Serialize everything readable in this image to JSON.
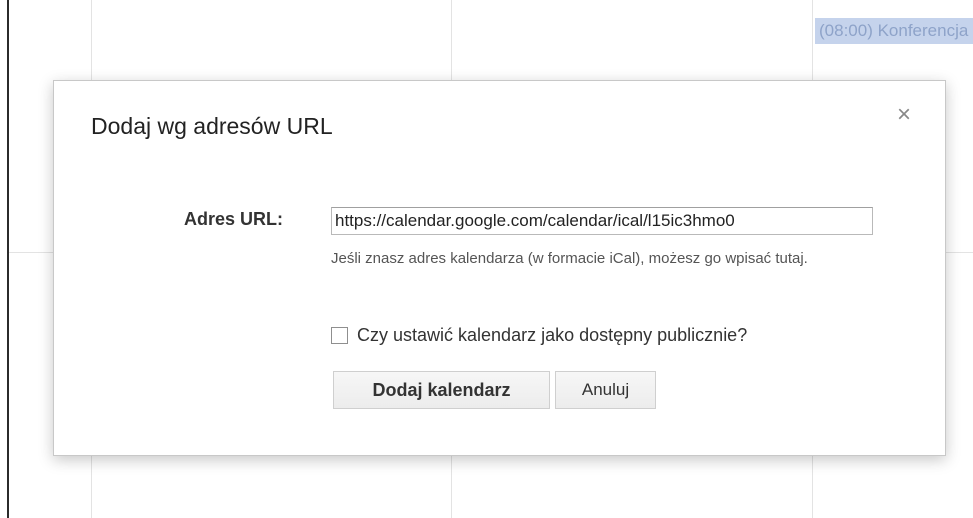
{
  "background": {
    "event_chip": "(08:00) Konferencja"
  },
  "dialog": {
    "title": "Dodaj wg adresów URL",
    "close_glyph": "×",
    "url_label": "Adres URL:",
    "url_value": "https://calendar.google.com/calendar/ical/l15ic3hmo0",
    "hint": "Jeśli znasz adres kalendarza (w formacie iCal), możesz go wpisać tutaj.",
    "public_label": "Czy ustawić kalendarz jako dostępny publicznie?",
    "public_checked": false,
    "add_button": "Dodaj kalendarz",
    "cancel_button": "Anuluj"
  },
  "icons": {
    "close": "close-icon",
    "checkbox": "checkbox-icon"
  },
  "colors": {
    "event_chip_bg": "#c5d3ec",
    "event_chip_text": "#8ea3c9",
    "dialog_border": "#c8c8c8",
    "grid_line": "#e3e3e3"
  }
}
